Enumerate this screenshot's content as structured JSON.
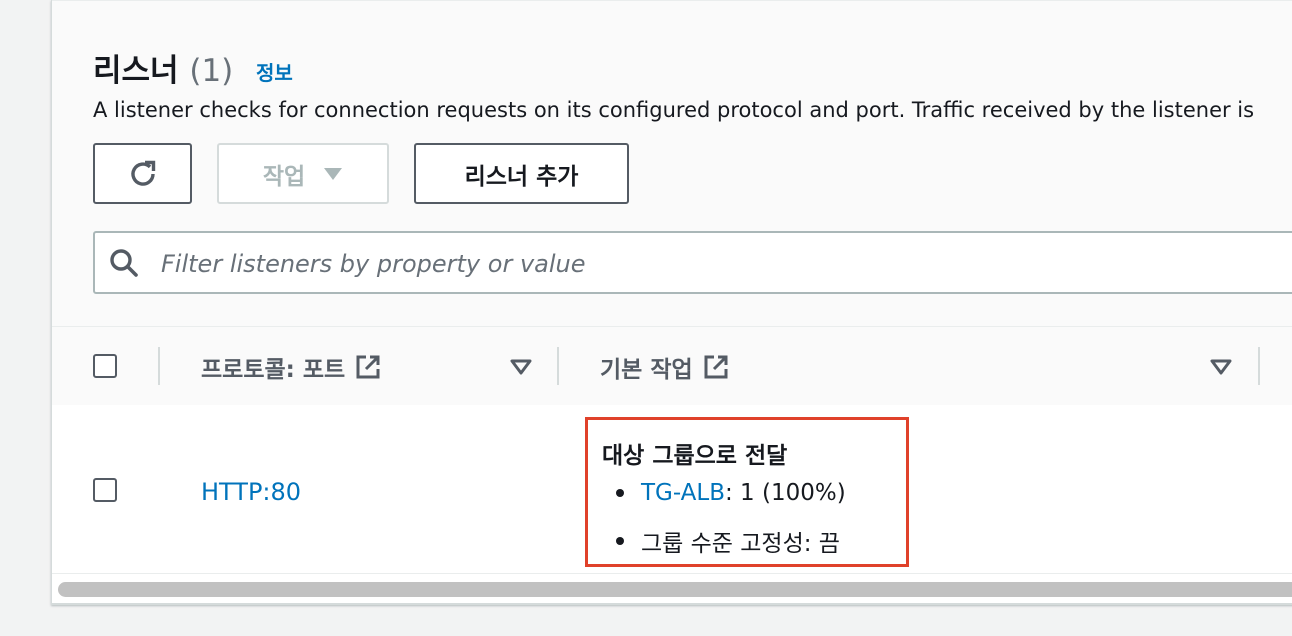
{
  "section": {
    "title": "리스너",
    "count": "(1)",
    "info_link": "정보",
    "description": "A listener checks for connection requests on its configured protocol and port. Traffic received by the listener is"
  },
  "toolbar": {
    "refresh_icon": "refresh-icon",
    "actions_label": "작업",
    "add_listener_label": "리스너 추가"
  },
  "search": {
    "placeholder": "Filter listeners by property or value",
    "value": ""
  },
  "table": {
    "columns": [
      {
        "label": "프로토콜: 포트"
      },
      {
        "label": "기본 작업"
      }
    ],
    "rows": [
      {
        "protocol_port": "HTTP:80",
        "default_action": {
          "title": "대상 그룹으로 전달",
          "target_group_link": "TG-ALB",
          "target_group_weight": ": 1 (100%)",
          "stickiness": "그룹 수준 고정성: 끔"
        }
      }
    ]
  },
  "colors": {
    "link": "#0073bb",
    "highlight_border": "#e0412a",
    "text": "#16191f",
    "muted": "#545b64"
  }
}
